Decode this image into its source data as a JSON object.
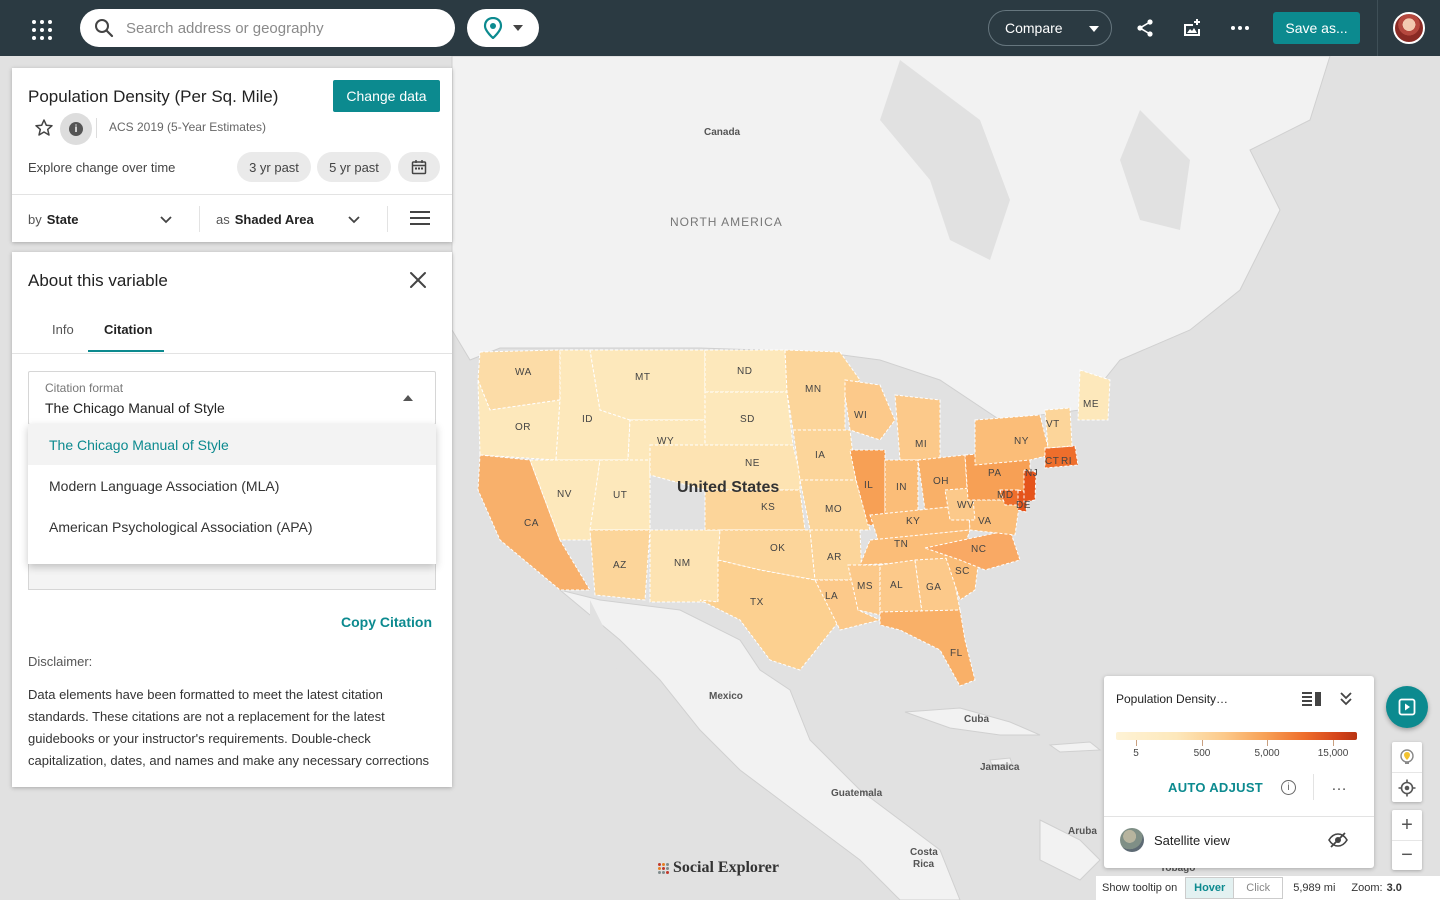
{
  "topbar": {
    "search_placeholder": "Search address or geography",
    "compare_label": "Compare",
    "save_label": "Save as..."
  },
  "data_panel": {
    "title": "Population Density (Per Sq. Mile)",
    "change_label": "Change data",
    "survey": "ACS 2019 (5-Year Estimates)",
    "explore_label": "Explore change over time",
    "past_3": "3 yr past",
    "past_5": "5 yr past",
    "by_prefix": "by",
    "by_value": "State",
    "as_prefix": "as",
    "as_value": "Shaded Area"
  },
  "about": {
    "title": "About this variable",
    "tabs": [
      {
        "label": "Info",
        "active": false
      },
      {
        "label": "Citation",
        "active": true
      }
    ],
    "citation_format_label": "Citation format",
    "citation_format_value": "The Chicago Manual of Style",
    "options": [
      "The Chicago Manual of Style",
      "Modern Language Association (MLA)",
      "American Psychological Association (APA)"
    ],
    "copy_label": "Copy Citation",
    "disclaimer_title": "Disclaimer:",
    "disclaimer_text": "Data elements have been formatted to meet the latest citation standards. These citations are not a replacement for the latest guidebooks or your instructor's requirements. Double-check capitalization, dates, and names and make any necessary corrections"
  },
  "map": {
    "labels": {
      "canada": "Canada",
      "north_america": "NORTH AMERICA",
      "united_states": "United States",
      "mexico": "Mexico",
      "cuba": "Cuba",
      "jamaica": "Jamaica",
      "guatemala": "Guatemala",
      "aruba": "Aruba",
      "costa_rica_1": "Costa",
      "costa_rica_2": "Rica",
      "tobago": "Tobago"
    },
    "states": {
      "wa": "WA",
      "or": "OR",
      "ca": "CA",
      "id": "ID",
      "nv": "NV",
      "mt": "MT",
      "wy": "WY",
      "ut": "UT",
      "az": "AZ",
      "nm": "NM",
      "nd": "ND",
      "sd": "SD",
      "ne": "NE",
      "ks": "KS",
      "ok": "OK",
      "tx": "TX",
      "mn": "MN",
      "ia": "IA",
      "mo": "MO",
      "ar": "AR",
      "la": "LA",
      "wi": "WI",
      "il": "IL",
      "mi": "MI",
      "in": "IN",
      "oh": "OH",
      "ky": "KY",
      "tn": "TN",
      "ms": "MS",
      "al": "AL",
      "ga": "GA",
      "fl": "FL",
      "sc": "SC",
      "nc": "NC",
      "va": "VA",
      "wv": "WV",
      "pa": "PA",
      "ny": "NY",
      "md": "MD",
      "de": "DE",
      "nj": "NJ",
      "ct": "CT",
      "ri": "RI",
      "vt": "VT",
      "me": "ME"
    },
    "brand": "Social Explorer",
    "colors": {
      "water": "#e1e1e1",
      "land": "#f2f2f2",
      "low": "#fde8bb",
      "mid": "#fbc98a",
      "high": "#f0883a",
      "top": "#e5541b",
      "accent": "#0c8a8f"
    }
  },
  "legend": {
    "title": "Population Density…",
    "ramp_values": [
      "5",
      "500",
      "5,000",
      "15,000"
    ],
    "auto_adjust": "AUTO ADJUST",
    "satellite_label": "Satellite view"
  },
  "status": {
    "tooltip_label": "Show tooltip on",
    "hover": "Hover",
    "click": "Click",
    "distance": "5,989 mi",
    "zoom_label": "Zoom:",
    "zoom_value": "3.0"
  }
}
